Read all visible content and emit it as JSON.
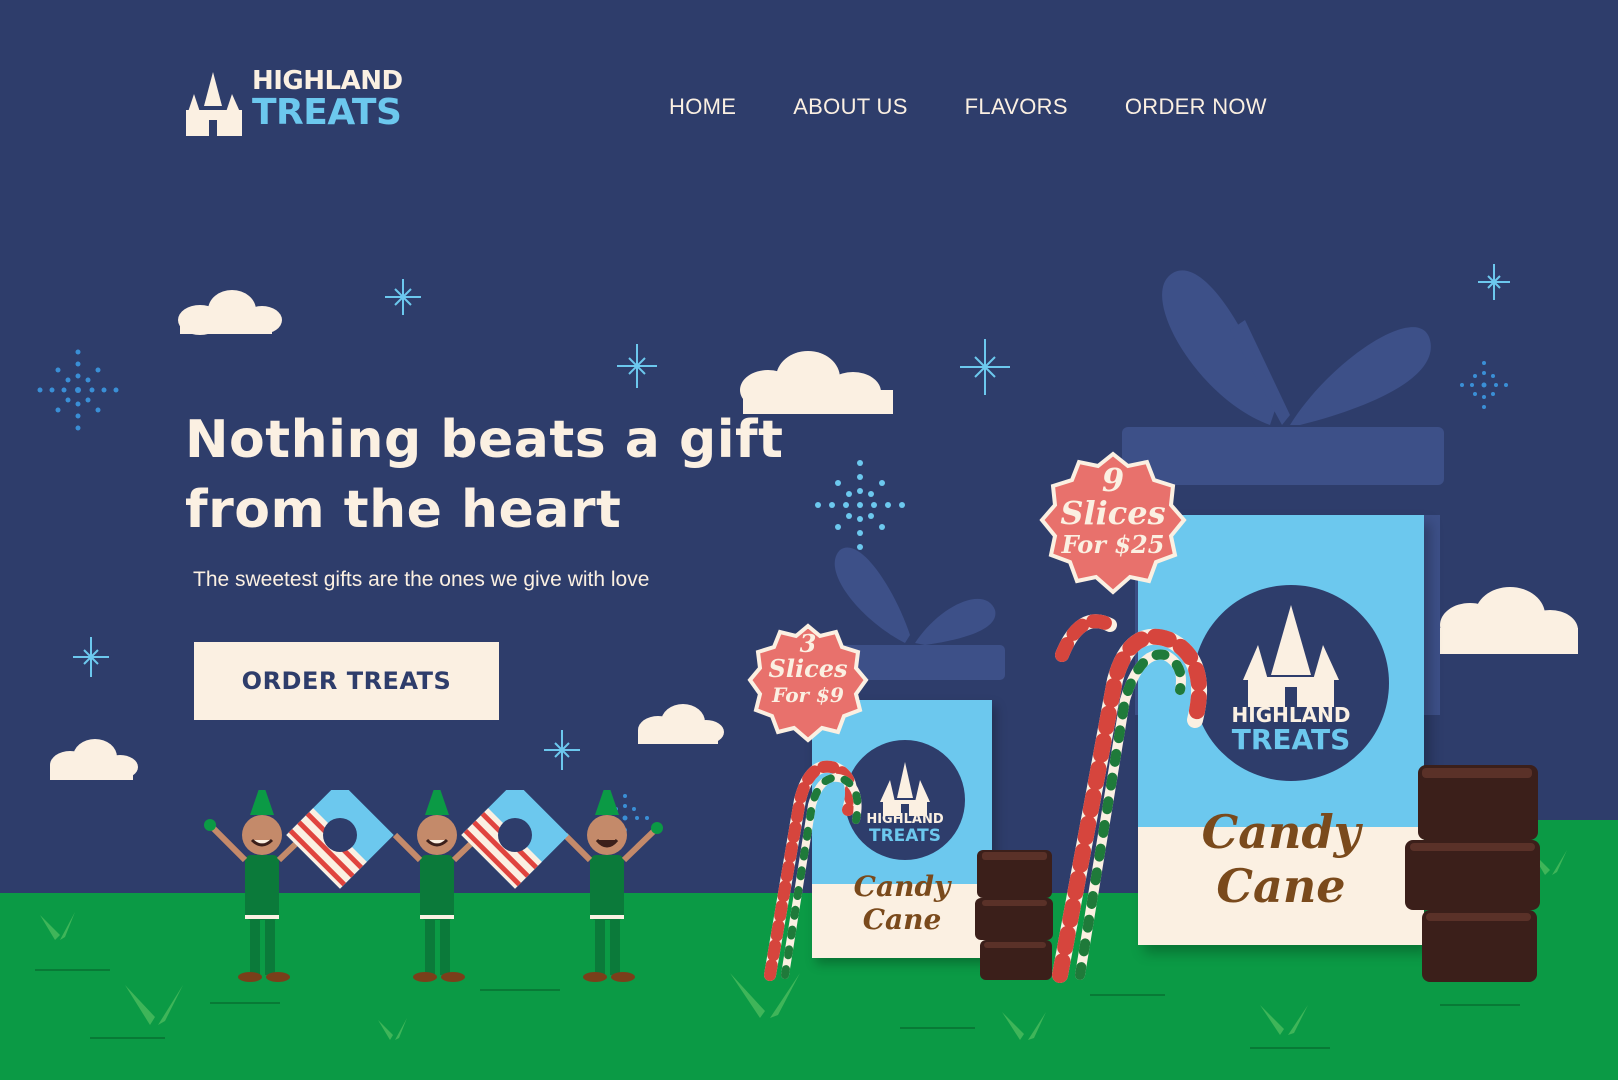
{
  "brand": {
    "name_top": "HIGHLAND",
    "name_bottom": "TREATS"
  },
  "nav": {
    "items": [
      {
        "label": "HOME"
      },
      {
        "label": "ABOUT US"
      },
      {
        "label": "FLAVORS"
      },
      {
        "label": "ORDER NOW"
      }
    ]
  },
  "hero": {
    "headline_line1": "Nothing beats a gift",
    "headline_line2": "from the heart",
    "subline": "The sweetest gifts are the ones we give with love",
    "cta_label": "ORDER TREATS"
  },
  "products": {
    "small_box": {
      "brand_top": "HIGHLAND",
      "brand_bottom": "TREATS",
      "flavor": "Candy Cane",
      "badge_count": "3",
      "badge_unit": "Slices",
      "badge_price": "For $9"
    },
    "large_box": {
      "brand_top": "HIGHLAND",
      "brand_bottom": "TREATS",
      "flavor": "Candy Cane",
      "badge_count": "9",
      "badge_unit": "Slices",
      "badge_price": "For $25"
    }
  },
  "colors": {
    "background": "#2e3d6b",
    "cream": "#fbf0e2",
    "sky_blue": "#6cc8ee",
    "grass": "#0b9a45",
    "badge": "#e8716c",
    "chocolate": "#3b1f1a"
  }
}
